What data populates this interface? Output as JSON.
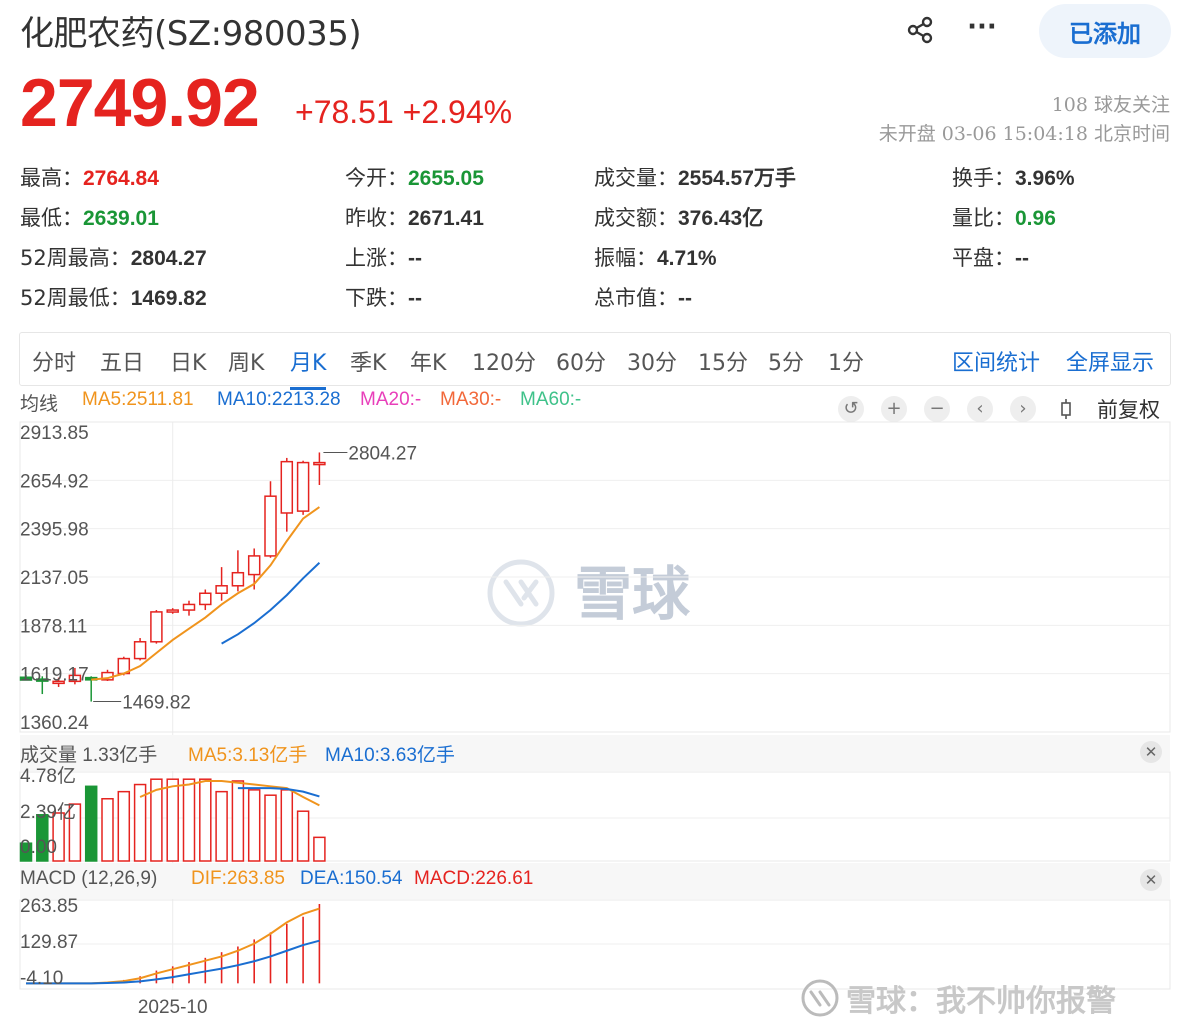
{
  "header": {
    "title": "化肥农药(SZ:980035)",
    "added_label": "已添加",
    "price": "2749.92",
    "change": "+78.51",
    "change_pct": "+2.94%",
    "followers": "108 球友关注",
    "status": "未开盘 03-06 15:04:18 北京时间"
  },
  "stats": [
    {
      "label": "最高：",
      "value": "2764.84",
      "color": "red"
    },
    {
      "label": "今开：",
      "value": "2655.05",
      "color": "green"
    },
    {
      "label": "成交量：",
      "value": "2554.57万手",
      "color": "black"
    },
    {
      "label": "换手：",
      "value": "3.96%",
      "color": "black"
    },
    {
      "label": "最低：",
      "value": "2639.01",
      "color": "green"
    },
    {
      "label": "昨收：",
      "value": "2671.41",
      "color": "black"
    },
    {
      "label": "成交额：",
      "value": "376.43亿",
      "color": "black"
    },
    {
      "label": "量比：",
      "value": "0.96",
      "color": "green"
    },
    {
      "label": "52周最高：",
      "value": "2804.27",
      "color": "black"
    },
    {
      "label": "上涨：",
      "value": "--",
      "color": "black"
    },
    {
      "label": "振幅：",
      "value": "4.71%",
      "color": "black"
    },
    {
      "label": "平盘：",
      "value": "--",
      "color": "black"
    },
    {
      "label": "52周最低：",
      "value": "1469.82",
      "color": "black"
    },
    {
      "label": "下跌：",
      "value": "--",
      "color": "black"
    },
    {
      "label": "总市值：",
      "value": "--",
      "color": "black"
    }
  ],
  "tabs": [
    "分时",
    "五日",
    "日K",
    "周K",
    "月K",
    "季K",
    "年K",
    "120分",
    "60分",
    "30分",
    "15分",
    "5分",
    "1分"
  ],
  "active_tab": "月K",
  "tab_actions": [
    "区间统计",
    "全屏显示"
  ],
  "ma_legend": {
    "label": "均线",
    "ma5": "MA5:2511.81",
    "ma10": "MA10:2213.28",
    "ma20": "MA20:-",
    "ma30": "MA30:-",
    "ma60": "MA60:-"
  },
  "adjust_label": "前复权",
  "volume_legend": {
    "label": "成交量 1.33亿手",
    "ma5": "MA5:3.13亿手",
    "ma10": "MA10:3.63亿手"
  },
  "macd_legend": {
    "label": "MACD (12,26,9)",
    "dif": "DIF:263.85",
    "dea": "DEA:150.54",
    "macd": "MACD:226.61"
  },
  "watermark": "雪球",
  "footer_watermark": "雪球：我不帅你报警",
  "colors": {
    "up": "#e5231f",
    "down": "#1a9636",
    "accent": "#1a6ed1",
    "ma5": "#f0941d",
    "ma10": "#1a6ed1",
    "ma20": "#e83fba",
    "ma30": "#f2683a",
    "ma60": "#3fc28a"
  },
  "chart_data": {
    "type": "candlestick",
    "price_axis": {
      "ticks": [
        "2913.85",
        "2654.92",
        "2395.98",
        "2137.05",
        "1878.11",
        "1619.17",
        "1360.24"
      ],
      "ylim": [
        1360.24,
        2913.85
      ]
    },
    "annotations": {
      "high": "2804.27",
      "low": "1469.82"
    },
    "x_label": "2025-10",
    "candles": [
      {
        "o": 1600,
        "h": 1612,
        "l": 1588,
        "c": 1585
      },
      {
        "o": 1590,
        "h": 1605,
        "l": 1510,
        "c": 1580
      },
      {
        "o": 1575,
        "h": 1598,
        "l": 1548,
        "c": 1578
      },
      {
        "o": 1578,
        "h": 1650,
        "l": 1562,
        "c": 1610
      },
      {
        "o": 1598,
        "h": 1605,
        "l": 1469.82,
        "c": 1586
      },
      {
        "o": 1586,
        "h": 1640,
        "l": 1580,
        "c": 1625
      },
      {
        "o": 1620,
        "h": 1710,
        "l": 1610,
        "c": 1700
      },
      {
        "o": 1700,
        "h": 1810,
        "l": 1690,
        "c": 1790
      },
      {
        "o": 1790,
        "h": 1960,
        "l": 1780,
        "c": 1950
      },
      {
        "o": 1950,
        "h": 1970,
        "l": 1940,
        "c": 1960
      },
      {
        "o": 1960,
        "h": 2010,
        "l": 1930,
        "c": 1990
      },
      {
        "o": 1990,
        "h": 2070,
        "l": 1960,
        "c": 2050
      },
      {
        "o": 2050,
        "h": 2190,
        "l": 2010,
        "c": 2090
      },
      {
        "o": 2090,
        "h": 2280,
        "l": 2060,
        "c": 2160
      },
      {
        "o": 2150,
        "h": 2290,
        "l": 2070,
        "c": 2250
      },
      {
        "o": 2250,
        "h": 2650,
        "l": 2240,
        "c": 2570
      },
      {
        "o": 2480,
        "h": 2775,
        "l": 2380,
        "c": 2755
      },
      {
        "o": 2490,
        "h": 2760,
        "l": 2470,
        "c": 2750
      },
      {
        "o": 2750,
        "h": 2804.27,
        "l": 2630,
        "c": 2750
      }
    ],
    "ma5": [
      null,
      null,
      null,
      null,
      1587,
      1595,
      1620,
      1660,
      1730,
      1800,
      1860,
      1920,
      1990,
      2050,
      2100,
      2200,
      2330,
      2450,
      2511.81
    ],
    "ma10": [
      null,
      null,
      null,
      null,
      null,
      null,
      null,
      null,
      null,
      null,
      null,
      null,
      1780,
      1830,
      1890,
      1960,
      2040,
      2130,
      2213.28
    ],
    "volume": {
      "ticks": [
        "4.78亿",
        "2.39亿",
        "0.00"
      ],
      "ylim": [
        0,
        4.78
      ],
      "values": [
        1.0,
        2.6,
        2.7,
        3.2,
        4.2,
        3.5,
        3.9,
        4.3,
        4.6,
        4.6,
        4.6,
        4.6,
        3.9,
        4.5,
        4.0,
        3.7,
        4.0,
        2.8,
        1.33
      ],
      "ma5": [
        null,
        null,
        null,
        null,
        null,
        null,
        null,
        3.6,
        4.0,
        4.2,
        4.3,
        4.5,
        4.5,
        4.4,
        4.3,
        4.2,
        4.1,
        3.6,
        3.13
      ],
      "ma10": [
        null,
        null,
        null,
        null,
        null,
        null,
        null,
        null,
        null,
        null,
        null,
        null,
        null,
        4.1,
        4.1,
        4.1,
        4.05,
        3.9,
        3.63
      ]
    },
    "macd": {
      "ticks": [
        "263.85",
        "129.87",
        "-4.10"
      ],
      "ylim": [
        -20,
        280
      ],
      "hist": [
        0,
        0,
        0,
        0,
        0,
        5,
        12,
        25,
        45,
        60,
        75,
        90,
        110,
        130,
        155,
        180,
        210,
        235,
        280
      ],
      "dif": [
        0,
        0,
        0,
        0,
        0,
        3,
        8,
        18,
        35,
        50,
        65,
        80,
        95,
        115,
        140,
        175,
        215,
        245,
        263.85
      ],
      "dea": [
        0,
        0,
        0,
        0,
        0,
        1,
        3,
        7,
        14,
        22,
        32,
        42,
        52,
        64,
        78,
        95,
        115,
        135,
        150.54
      ]
    }
  }
}
